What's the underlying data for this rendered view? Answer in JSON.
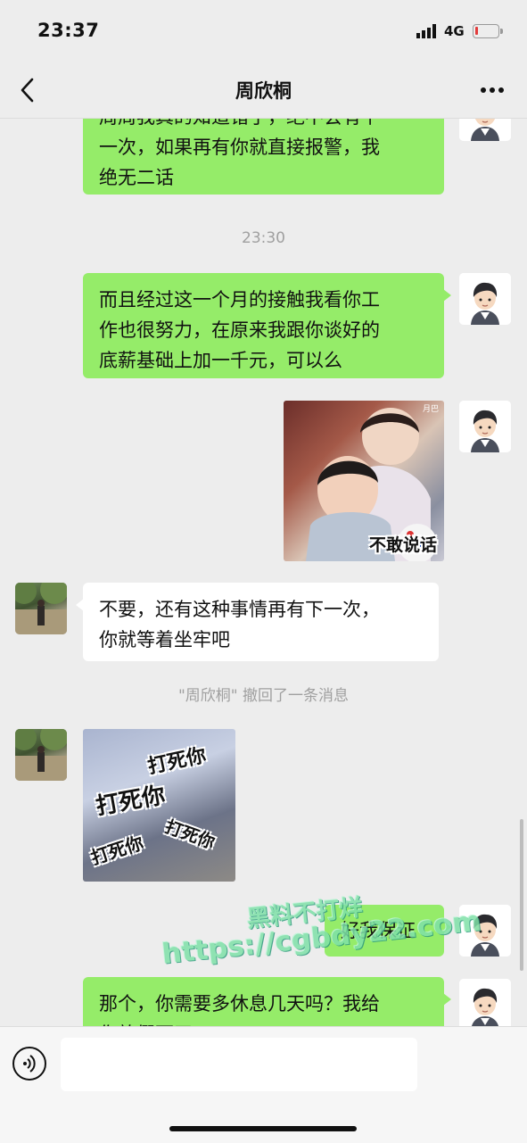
{
  "status_bar": {
    "time": "23:37",
    "network": "4G",
    "battery_level": 0.12
  },
  "nav": {
    "title": "周欣桐",
    "back_icon": "chevron-left-icon",
    "more_icon": "ellipsis-icon"
  },
  "messages": {
    "m1": {
      "side": "me",
      "lines": [
        "周周我真的知道错了，绝不会有下",
        "一次，如果再有你就直接报警，我",
        "绝无二话"
      ]
    },
    "ts1": "23:30",
    "m2": {
      "side": "me",
      "lines": [
        "而且经过这一个月的接触我看你工",
        "作也很努力，在原来我跟你谈好的",
        "底薪基础上加一千元，可以么"
      ]
    },
    "m3": {
      "side": "me",
      "type": "sticker",
      "caption": "不敢说话",
      "tag": "月巴"
    },
    "m4": {
      "side": "friend",
      "lines": [
        "不要，还有这种事情再有下一次，",
        "你就等着坐牢吧"
      ]
    },
    "recall": "\"周欣桐\" 撤回了一条消息",
    "m5": {
      "side": "friend",
      "type": "sticker",
      "texts": [
        "打死你",
        "打死你",
        "打死你",
        "打死你"
      ]
    },
    "m6": {
      "side": "me",
      "text": "好我保证"
    },
    "m7": {
      "side": "me",
      "lines": [
        "那个，你需要多休息几天吗？我给",
        "你放假两天"
      ]
    }
  },
  "watermark": {
    "line1": "黑料不打烊",
    "line2": "https://cgbdy22.com"
  },
  "input": {
    "voice_icon": "voice-icon",
    "placeholder": ""
  }
}
